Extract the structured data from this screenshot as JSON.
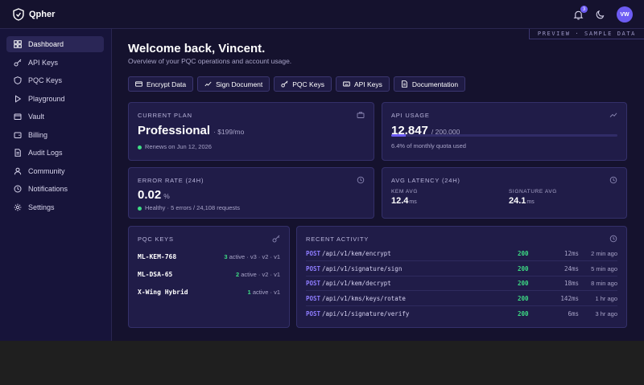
{
  "brand": {
    "name": "Qpher"
  },
  "header": {
    "notification_count": "3",
    "avatar_initials": "VW"
  },
  "sidebar": {
    "items": [
      {
        "label": "Dashboard",
        "icon": "grid-icon",
        "active": true
      },
      {
        "label": "API Keys",
        "icon": "key-icon"
      },
      {
        "label": "PQC Keys",
        "icon": "shield-icon"
      },
      {
        "label": "Playground",
        "icon": "play-icon"
      },
      {
        "label": "Vault",
        "icon": "vault-icon"
      },
      {
        "label": "Billing",
        "icon": "wallet-icon"
      },
      {
        "label": "Audit Logs",
        "icon": "document-icon"
      },
      {
        "label": "Community",
        "icon": "user-icon"
      },
      {
        "label": "Notifications",
        "icon": "clock-icon"
      },
      {
        "label": "Settings",
        "icon": "gear-icon"
      }
    ]
  },
  "main": {
    "preview_badge": "PREVIEW · SAMPLE DATA",
    "welcome": "Welcome back, Vincent.",
    "subtitle": "Overview of your PQC operations and account usage.",
    "actions": [
      {
        "label": "Encrypt Data",
        "icon": "card-icon"
      },
      {
        "label": "Sign Document",
        "icon": "signature-icon"
      },
      {
        "label": "PQC Keys",
        "icon": "key-icon"
      },
      {
        "label": "API Keys",
        "icon": "keyboard-icon"
      },
      {
        "label": "Documentation",
        "icon": "document-icon"
      }
    ]
  },
  "plan": {
    "title": "CURRENT PLAN",
    "name": "Professional",
    "price": "· $199/mo",
    "renews": "Renews on Jun 12, 2026"
  },
  "usage": {
    "title": "API USAGE",
    "value": "12,847",
    "limit": "/ 200,000",
    "progress_percent": 6.4,
    "note": "6.4% of monthly quota used"
  },
  "error_rate": {
    "title": "ERROR RATE (24H)",
    "value": "0.02",
    "unit": "%",
    "status": "Healthy · 5 errors / 24,108 requests"
  },
  "latency": {
    "title": "AVG LATENCY (24H)",
    "kem_label": "KEM AVG",
    "kem_value": "12.4",
    "kem_unit": "ms",
    "sig_label": "SIGNATURE AVG",
    "sig_value": "24.1",
    "sig_unit": "ms"
  },
  "pqc_keys": {
    "title": "PQC KEYS",
    "rows": [
      {
        "name": "ML-KEM-768",
        "count": "3",
        "detail": "active · v3 · v2 · v1"
      },
      {
        "name": "ML-DSA-65",
        "count": "2",
        "detail": "active · v2 · v1"
      },
      {
        "name": "X-Wing Hybrid",
        "count": "1",
        "detail": "active · v1"
      }
    ]
  },
  "activity": {
    "title": "RECENT ACTIVITY",
    "rows": [
      {
        "method": "POST",
        "path": "/api/v1/kem/encrypt",
        "status": "200",
        "duration": "12ms",
        "ago": "2 min ago"
      },
      {
        "method": "POST",
        "path": "/api/v1/signature/sign",
        "status": "200",
        "duration": "24ms",
        "ago": "5 min ago"
      },
      {
        "method": "POST",
        "path": "/api/v1/kem/decrypt",
        "status": "200",
        "duration": "18ms",
        "ago": "8 min ago"
      },
      {
        "method": "POST",
        "path": "/api/v1/kms/keys/rotate",
        "status": "200",
        "duration": "142ms",
        "ago": "1 hr ago"
      },
      {
        "method": "POST",
        "path": "/api/v1/signature/verify",
        "status": "200",
        "duration": "6ms",
        "ago": "3 hr ago"
      }
    ]
  },
  "colors": {
    "accent": "#6d5cf3",
    "success": "#3ddc84",
    "background": "#15122e",
    "card": "#201c48"
  }
}
